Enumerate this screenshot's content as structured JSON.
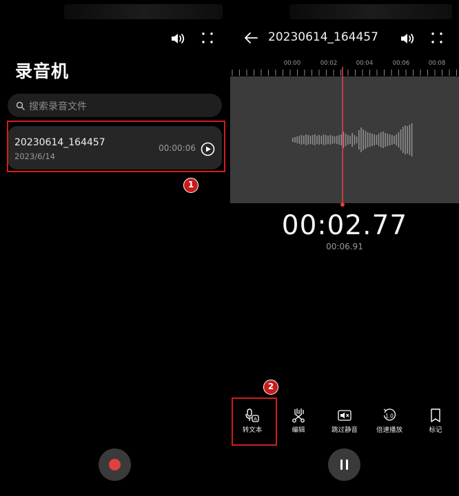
{
  "left": {
    "app_title": "录音机",
    "search_placeholder": "搜索录音文件",
    "recording": {
      "name": "20230614_164457",
      "date": "2023/6/14",
      "duration": "00:00:06"
    },
    "step_badge": "1"
  },
  "right": {
    "file_title": "20230614_164457",
    "ruler_labels": [
      "00:00",
      "00:02",
      "00:04",
      "00:06",
      "00:08"
    ],
    "current_time": "00:02.77",
    "total_time": "00:06.91",
    "step_badge": "2",
    "toolbar": [
      {
        "label": "转文本",
        "icon": "speech-to-text-icon"
      },
      {
        "label": "编辑",
        "icon": "scissors-icon"
      },
      {
        "label": "跳过静音",
        "icon": "skip-silence-icon"
      },
      {
        "label": "倍速播放",
        "icon": "playback-speed-icon",
        "icon_text": "1.0"
      },
      {
        "label": "标记",
        "icon": "bookmark-icon"
      }
    ]
  },
  "colors": {
    "accent_red": "#d11d1d",
    "playhead": "#e0403f",
    "record_dot": "#e0403f"
  }
}
